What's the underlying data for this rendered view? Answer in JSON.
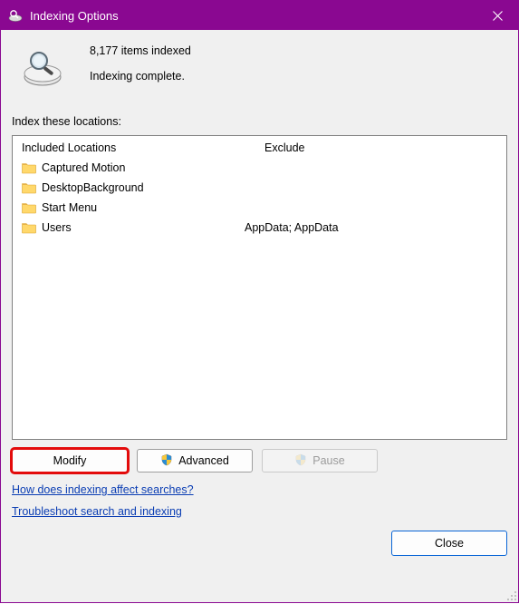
{
  "window": {
    "title": "Indexing Options"
  },
  "status": {
    "count_text": "8,177 items indexed",
    "state_text": "Indexing complete."
  },
  "section_label": "Index these locations:",
  "columns": {
    "included": "Included Locations",
    "exclude": "Exclude"
  },
  "locations": [
    {
      "name": "Captured Motion",
      "exclude": ""
    },
    {
      "name": "DesktopBackground",
      "exclude": ""
    },
    {
      "name": "Start Menu",
      "exclude": ""
    },
    {
      "name": "Users",
      "exclude": "AppData; AppData"
    }
  ],
  "buttons": {
    "modify": "Modify",
    "advanced": "Advanced",
    "pause": "Pause",
    "close": "Close"
  },
  "links": {
    "how": "How does indexing affect searches?",
    "troubleshoot": "Troubleshoot search and indexing"
  },
  "colors": {
    "accent": "#8a0891",
    "link": "#0a3db3",
    "highlight": "#e30b0b"
  }
}
